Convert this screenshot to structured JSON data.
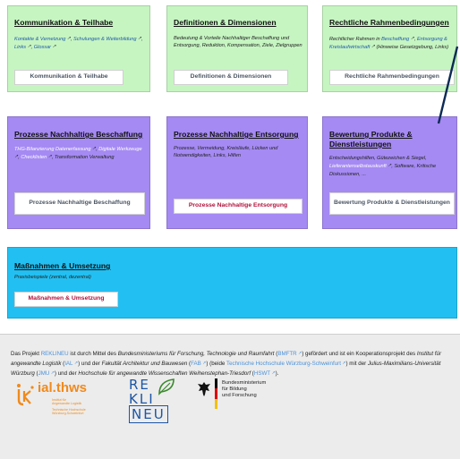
{
  "cards": [
    {
      "title": "Kommunikation & Teilhabe",
      "desc": [
        {
          "t": "Kontakte & Vernetzung",
          "link": true
        },
        {
          "t": ", ",
          "link": false
        },
        {
          "t": "Schulungen & Weiterbildung",
          "link": true
        },
        {
          "t": ", ",
          "link": false
        },
        {
          "t": "Links",
          "link": true
        },
        {
          "t": ", ",
          "link": false
        },
        {
          "t": "Glossar",
          "link": true
        }
      ],
      "button": "Kommunikation & Teilhabe"
    },
    {
      "title": "Definitionen & Dimensionen",
      "desc": [
        {
          "t": "Bedeutung & Vorteile Nachhaltiger Beschaffung und Entsorgung, Reduktion, Kompensation, Ziele, Zielgruppen",
          "link": false
        }
      ],
      "button": "Definitionen & Dimensionen"
    },
    {
      "title": "Rechtliche Rahmenbedingungen",
      "desc": [
        {
          "t": "Rechtlicher Rahmen in ",
          "link": false
        },
        {
          "t": "Beschaffung",
          "link": true
        },
        {
          "t": ", ",
          "link": false
        },
        {
          "t": "Entsorgung & Kreislaufwirtschaft",
          "link": true
        },
        {
          "t": " (Hinweise Gesetzgebung, Links)",
          "link": false
        }
      ],
      "button": "Rechtliche Rahmenbedingungen"
    },
    {
      "title": "Prozesse Nachhaltige Beschaffung",
      "desc": [
        {
          "t": "THG-Bilanzierung Datenerfassung",
          "link": true
        },
        {
          "t": ", ",
          "link": false
        },
        {
          "t": "Digitale Werkzeuge",
          "link": true
        },
        {
          "t": ", ",
          "link": false
        },
        {
          "t": "Checklisten",
          "link": true
        },
        {
          "t": ", Transformation Verwaltung",
          "link": false
        }
      ],
      "button": "Prozesse Nachhaltige Beschaffung"
    },
    {
      "title": "Prozesse Nachhaltige Entsorgung",
      "desc": [
        {
          "t": "Prozesse, Vermeidung, Kreisläufe, Lücken und Notwendigkeiten, Links, Hilfen",
          "link": false
        }
      ],
      "button": "Prozesse Nachhaltige Entsorgung"
    },
    {
      "title": "Bewertung Produkte & Dienstleistungen",
      "desc": [
        {
          "t": "Entscheidungshilfen, Gütezeichen & Siegel, ",
          "link": false
        },
        {
          "t": "Lieferantenselbstauskunft",
          "link": true
        },
        {
          "t": ", Software, Kritische Diskussionen, ...",
          "link": false
        }
      ],
      "button": "Bewertung Produkte & Dienstleistungen"
    },
    {
      "title": "Maßnahmen & Umsetzung",
      "desc": [
        {
          "t": "Praxisbeispiele (zentral, dezentral)",
          "link": false
        }
      ],
      "button": "Maßnahmen & Umsetzung"
    }
  ],
  "footer": {
    "text": [
      {
        "t": "Das Projekt ",
        "k": "plain"
      },
      {
        "t": "REKLINEU",
        "k": "link"
      },
      {
        "t": " ist durch Mittel des ",
        "k": "plain"
      },
      {
        "t": "Bundesministeriums für Forschung, Technologie und Raumfahrt",
        "k": "italic"
      },
      {
        "t": " (",
        "k": "plain"
      },
      {
        "t": "BMFTR",
        "k": "link",
        "ext": true
      },
      {
        "t": ") gefördert und ist ein Kooperationsprojekt des ",
        "k": "plain"
      },
      {
        "t": "Institut für angewandte Logistik",
        "k": "italic"
      },
      {
        "t": " (",
        "k": "plain"
      },
      {
        "t": "IAL",
        "k": "link",
        "ext": true
      },
      {
        "t": ") und der ",
        "k": "plain"
      },
      {
        "t": "Fakultät Architektur und Bauwesen",
        "k": "italic"
      },
      {
        "t": " (",
        "k": "plain"
      },
      {
        "t": "FAB",
        "k": "link",
        "ext": true
      },
      {
        "t": ") (beide ",
        "k": "plain"
      },
      {
        "t": "Technische Hochschule Würzburg-Schweinfurt",
        "k": "link",
        "ext": true
      },
      {
        "t": ") mit der ",
        "k": "plain"
      },
      {
        "t": "Julius-Maximilians-Universität Würzburg",
        "k": "italic"
      },
      {
        "t": " (",
        "k": "plain"
      },
      {
        "t": "JMU",
        "k": "link",
        "ext": true
      },
      {
        "t": ") und der ",
        "k": "plain"
      },
      {
        "t": "Hochschule für angewandte Wissenschaften Weihenstephan-Triesdorf",
        "k": "italic"
      },
      {
        "t": " (",
        "k": "plain"
      },
      {
        "t": "HSWT",
        "k": "link",
        "ext": true
      },
      {
        "t": ").",
        "k": "plain"
      }
    ],
    "logos": {
      "ial": {
        "name": "ial.thws",
        "line1": "Institut für",
        "line2": "Angewandte Logistik",
        "line3": "Technische Hochschule",
        "line4": "Würzburg-Schweinfurt"
      },
      "reklineu": {
        "r1": "RE",
        "r2": "KLI",
        "r3": "NEU"
      },
      "bmbf": {
        "line1": "Bundesministerium",
        "line2": "für Bildung",
        "line3": "und Forschung"
      }
    }
  },
  "colors": {
    "green": "#c6f5c2",
    "violet": "#a58af3",
    "cyan": "#22c0f2",
    "button_red": "#b0103a",
    "link_blue": "#1e5aa8"
  },
  "icons": [
    "external-link-icon",
    "arrow-annotation"
  ]
}
